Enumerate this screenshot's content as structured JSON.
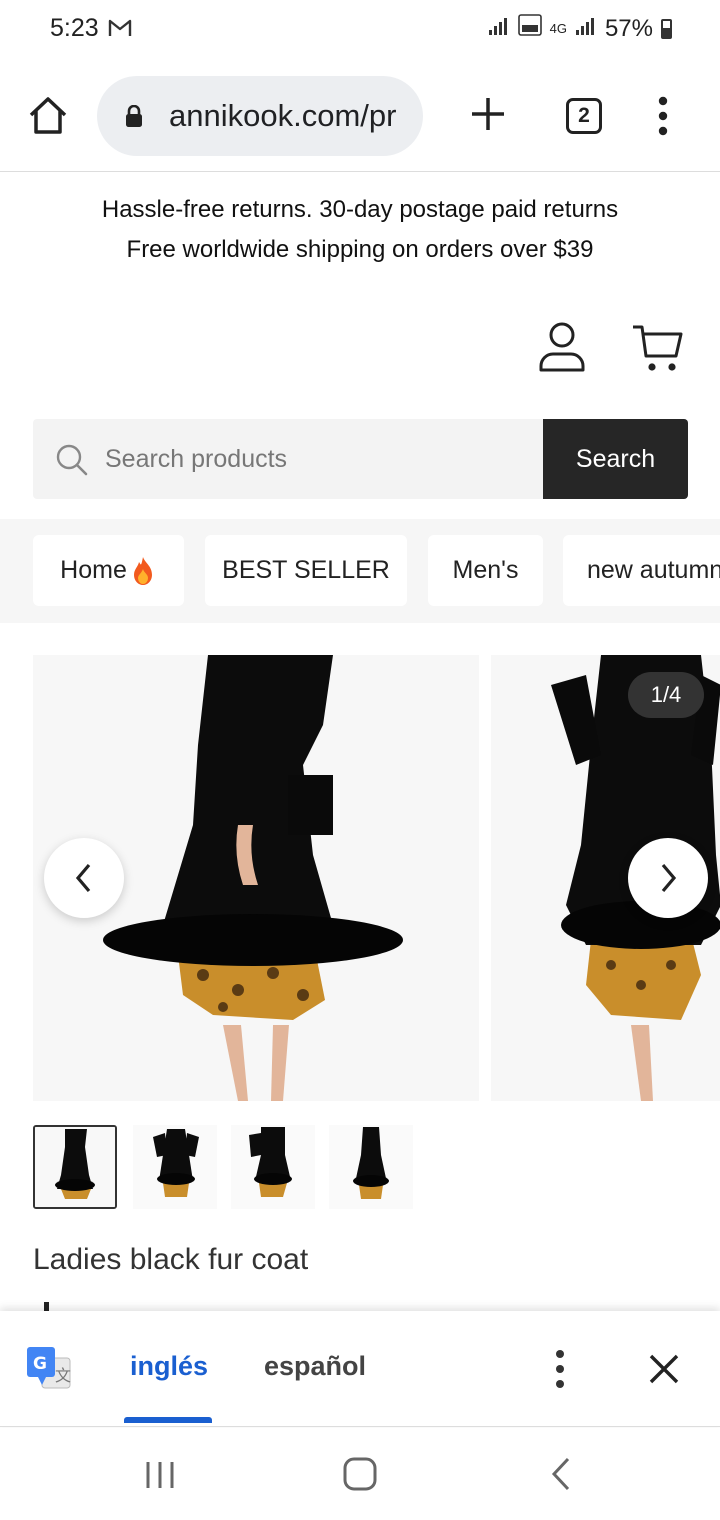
{
  "status_bar": {
    "time": "5:23",
    "mail_icon": "gmail-icon",
    "network_text": "4G",
    "battery": "57%",
    "battery_level": 0.57
  },
  "browser": {
    "url": "annikook.com/pr",
    "tab_count": "2",
    "icons": [
      "home-icon",
      "lock-icon",
      "plus-icon",
      "tabs-icon",
      "more-vert-icon"
    ]
  },
  "announcement": {
    "line1": "Hassle-free returns. 30-day postage paid returns",
    "line2": "Free worldwide shipping on orders over $39"
  },
  "header": {
    "icons": [
      "account-icon",
      "cart-icon"
    ]
  },
  "search": {
    "placeholder": "Search products",
    "button_label": "Search"
  },
  "categories": [
    {
      "label": "Home"
    },
    {
      "label": "BEST SELLER"
    },
    {
      "label": "Men's"
    },
    {
      "label": "new autumn"
    }
  ],
  "gallery": {
    "counter": "1/4",
    "thumbnail_count": 4
  },
  "product": {
    "title": "Ladies black fur coat"
  },
  "translate_bar": {
    "source_lang": "inglés",
    "target_lang": "español",
    "accent_color": "#1a5fd0"
  },
  "colors": {
    "search_button_bg": "#262626",
    "page_bg": "#ffffff"
  }
}
